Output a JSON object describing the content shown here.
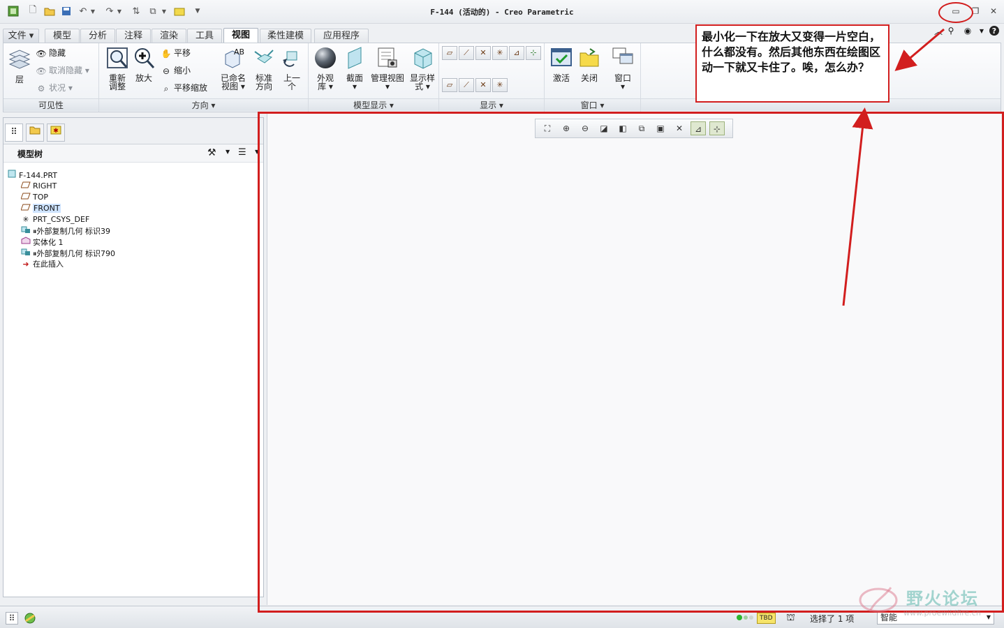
{
  "window": {
    "title": "F-144 (活动的) - Creo Parametric"
  },
  "ribbon": {
    "tabs": [
      "文件",
      "模型",
      "分析",
      "注释",
      "渲染",
      "工具",
      "视图",
      "柔性建模",
      "应用程序"
    ],
    "active_tab": "视图",
    "groups": {
      "visibility": {
        "label": "可见性",
        "layer": "层",
        "hide": "隐藏",
        "unhide": "取消隐藏",
        "status": "状况"
      },
      "orientation": {
        "label": "方向",
        "refit_line1": "重新",
        "refit_line2": "调整",
        "zoom_in": "放大",
        "pan": "平移",
        "zoom_out": "缩小",
        "pan_zoom": "平移缩放",
        "named_views_line1": "已命名",
        "named_views_line2": "视图",
        "standard_line1": "标准",
        "standard_line2": "方向",
        "previous_line1": "上一",
        "previous_line2": "个"
      },
      "model_display": {
        "label": "模型显示",
        "appearance_line1": "外观",
        "appearance_line2": "库",
        "section": "截面",
        "manage_views": "管理视图",
        "display_style_line1": "显示样",
        "display_style_line2": "式"
      },
      "show": {
        "label": "显示"
      },
      "window": {
        "label": "窗口",
        "activate": "激活",
        "close": "关闭",
        "windows": "窗口"
      }
    }
  },
  "model_tree": {
    "title": "模型树",
    "items": [
      {
        "label": "F-144.PRT",
        "icon": "part-icon"
      },
      {
        "label": "RIGHT",
        "icon": "datum-plane-icon"
      },
      {
        "label": "TOP",
        "icon": "datum-plane-icon"
      },
      {
        "label": "FRONT",
        "icon": "datum-plane-icon",
        "selected": true
      },
      {
        "label": "PRT_CSYS_DEF",
        "icon": "csys-icon"
      },
      {
        "label": "外部复制几何 标识39",
        "icon": "copy-geometry-icon"
      },
      {
        "label": "实体化 1",
        "icon": "solidify-icon"
      },
      {
        "label": "外部复制几何 标识790",
        "icon": "copy-geometry-icon"
      },
      {
        "label": "在此插入",
        "icon": "insert-here-icon"
      }
    ]
  },
  "status_bar": {
    "selection": "选择了 1 项",
    "filter": "智能",
    "tbd": "TBD"
  },
  "annotation": {
    "text": "最小化一下在放大又变得一片空白，什么都没有。然后其他东西在绘图区动一下就又卡住了。唉，怎么办？",
    "color": "#d21e1e"
  },
  "watermark": {
    "text": "野火论坛",
    "url": "www.proewildfire.cn"
  },
  "colors": {
    "selection_highlight": "#cfe4ff",
    "status_ok": "#2db52d"
  }
}
